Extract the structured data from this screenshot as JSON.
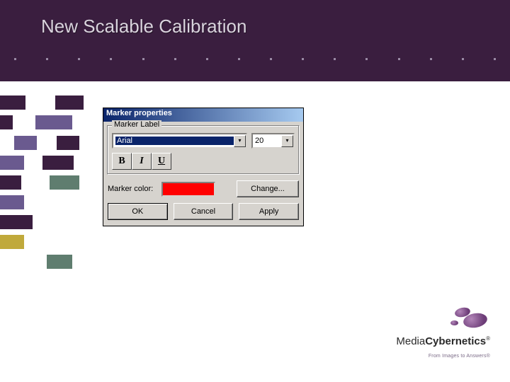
{
  "slide": {
    "title": "New Scalable Calibration"
  },
  "dialog": {
    "title": "Marker properties",
    "group_label": "Marker Label",
    "font_name": "Arial",
    "font_size": "20",
    "bold_label": "B",
    "italic_label": "I",
    "underline_label": "U",
    "color_label": "Marker color:",
    "marker_color": "#ff0000",
    "change_label": "Change...",
    "ok_label": "OK",
    "cancel_label": "Cancel",
    "apply_label": "Apply"
  },
  "logo": {
    "name_prefix": "Media",
    "name_bold": "Cybernetics",
    "reg": "®",
    "tagline": "From Images to Answers®"
  }
}
